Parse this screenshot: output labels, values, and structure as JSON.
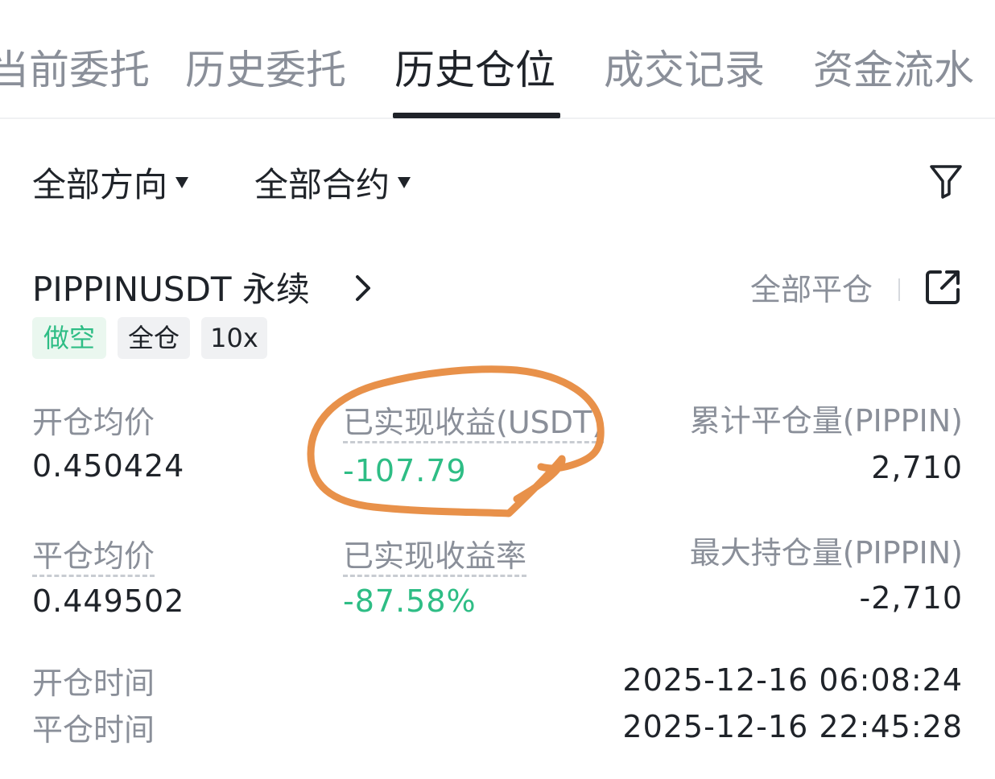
{
  "tabs": [
    {
      "label": "当前委托"
    },
    {
      "label": "历史委托"
    },
    {
      "label": "历史仓位",
      "active": true
    },
    {
      "label": "成交记录"
    },
    {
      "label": "资金流水"
    }
  ],
  "filters": {
    "direction": "全部方向",
    "contract": "全部合约"
  },
  "position": {
    "symbol": "PIPPINUSDT 永续",
    "close_all": "全部平仓",
    "tags": {
      "side": "做空",
      "margin": "全仓",
      "leverage": "10x"
    },
    "stats": {
      "open_avg_label": "开仓均价",
      "open_avg_value": "0.450424",
      "realized_pnl_label": "已实现收益(USDT)",
      "realized_pnl_value": "-107.79",
      "cum_close_label": "累计平仓量(PIPPIN)",
      "cum_close_value": "2,710",
      "close_avg_label": "平仓均价",
      "close_avg_value": "0.449502",
      "realized_rate_label": "已实现收益率",
      "realized_rate_value": "-87.58%",
      "max_hold_label": "最大持仓量(PIPPIN)",
      "max_hold_value": "-2,710"
    },
    "times": {
      "open_label": "开仓时间",
      "close_label": "平仓时间",
      "open_value": "2025-12-16 06:08:24",
      "close_value": "2025-12-16 22:45:28"
    }
  },
  "colors": {
    "accent_green": "#2ebd85",
    "annotation_orange": "#e8914a",
    "text_primary": "#1f2329",
    "text_secondary": "#8a8f99"
  },
  "icons": {
    "filter": "filter-icon",
    "chevron": "chevron-right-icon",
    "share": "share-icon"
  }
}
